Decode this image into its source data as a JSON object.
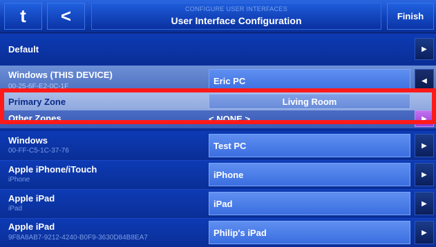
{
  "header": {
    "home_icon": "t",
    "back_icon": "<",
    "subtitle": "CONFIGURE USER INTERFACES",
    "title": "User Interface Configuration",
    "finish_label": "Finish"
  },
  "rows": [
    {
      "name": "Default",
      "sub": "",
      "value": ""
    },
    {
      "name": "Windows (THIS DEVICE)",
      "sub": "00-25-6F-E2-0C-1F",
      "value": "Eric PC"
    },
    {
      "name": "Primary Zone",
      "sub": "",
      "value": "Living Room"
    },
    {
      "name": "Other Zones",
      "sub": "",
      "value": "< NONE >"
    },
    {
      "name": "Windows",
      "sub": "00-FF-C5-1C-37-76",
      "value": "Test PC"
    },
    {
      "name": "Apple iPhone/iTouch",
      "sub": "iPhone",
      "value": "iPhone"
    },
    {
      "name": "Apple iPad",
      "sub": "iPad",
      "value": "iPad"
    },
    {
      "name": "Apple iPad",
      "sub": "9F8A8AB7-9212-4240-B0F9-3630D84B8EA7",
      "value": "Philip's iPad"
    }
  ],
  "icons": {
    "arrow_right": "▶",
    "arrow_left": "◀"
  },
  "colors": {
    "highlight": "#ff1a1a",
    "accent_purple": "#b04ee0"
  }
}
